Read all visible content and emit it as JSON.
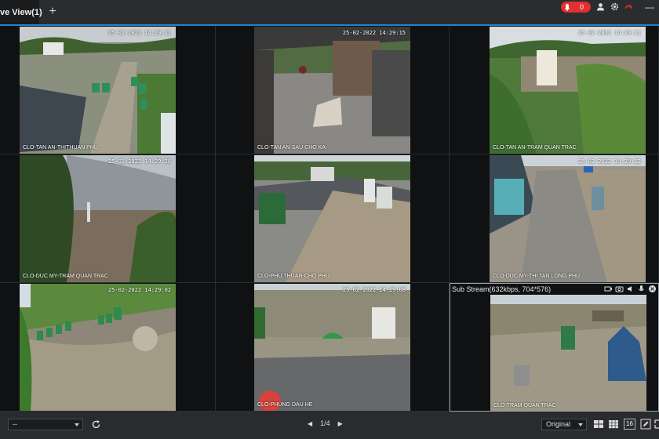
{
  "window": {
    "tab_title": "ve View(1)",
    "add_tab": "+",
    "alarm_count": "0",
    "minimize": "—"
  },
  "cameras": [
    {
      "label": "CLO-TAN AN-THITHUAN PHU",
      "timestamp": "25-02-2022 14:29:11"
    },
    {
      "label": "CLO-TAN AN-SAU CHO KA",
      "timestamp": "25-02-2022 14:29:15"
    },
    {
      "label": "CLO-TAN AN-TRAM QUAN TRAC",
      "timestamp": "25-02-2022 14:29:11"
    },
    {
      "label": "CLO-DUC MY-TRAM QUAN TRAC",
      "timestamp": "25-02-2022 14:29:20"
    },
    {
      "label": "CLO-PHU THUAN-CHO PHU",
      "timestamp": ""
    },
    {
      "label": "CLO-DUC MY-THI TAN LONG PHU",
      "timestamp": "25-02-2022 14:29:12"
    },
    {
      "label": "",
      "timestamp": "25-02-2022 14:29:02"
    },
    {
      "label": "CLO-PHUNG DAU HE",
      "timestamp": "25-02-2022 14:29:08"
    },
    {
      "label": "CLO-TRAM QUAN TRAC",
      "timestamp": ""
    }
  ],
  "selected_stream": "Sub Stream(632kbps, 704*576)",
  "bottom": {
    "view_select": "--",
    "page": "1/4",
    "ratio": "Original",
    "layout_count": "16"
  },
  "colors": {
    "accent": "#1b87c9",
    "alarm": "#e0312f",
    "background": "#1e1f21"
  },
  "icons": [
    "plus-icon",
    "bell-icon",
    "user-icon",
    "gear-icon",
    "speedometer-icon",
    "refresh-icon",
    "prev-page-icon",
    "next-page-icon",
    "layout-4-icon",
    "layout-9-icon",
    "fullscreen-icon",
    "edit-icon"
  ]
}
